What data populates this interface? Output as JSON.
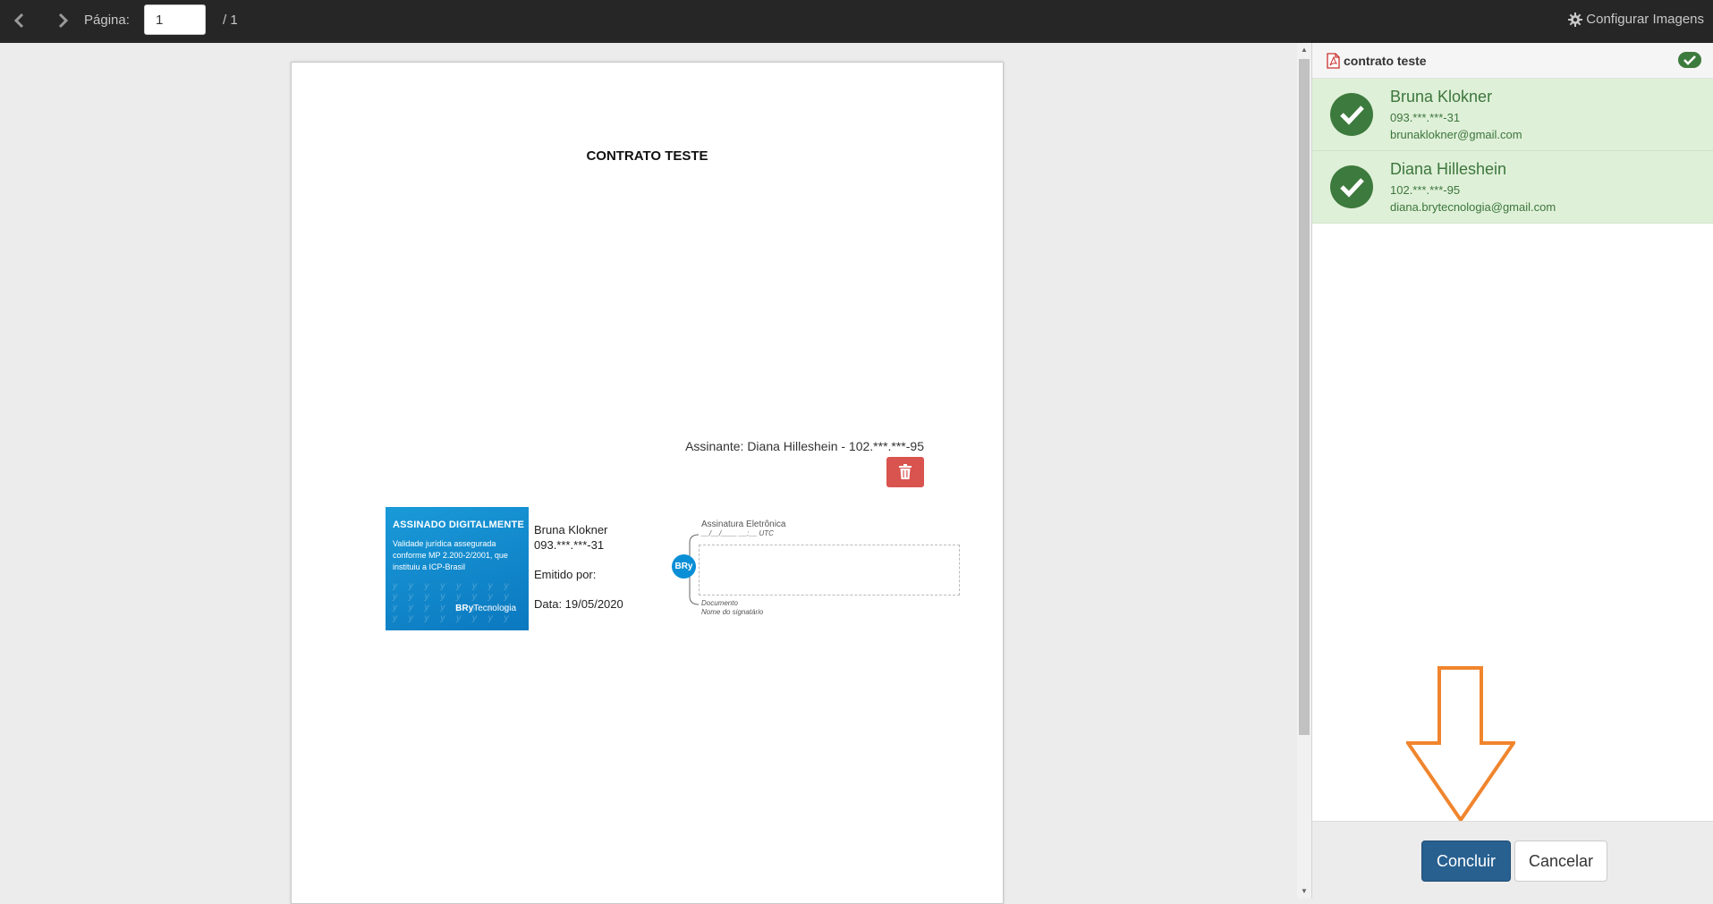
{
  "toolbar": {
    "page_label": "Página:",
    "page_value": "1",
    "page_total": "/ 1",
    "config_images_label": "Configurar Imagens"
  },
  "document": {
    "title": "CONTRATO TESTE",
    "signer_line": "Assinante: Diana Hilleshein - 102.***.***-95",
    "stamp": {
      "title": "ASSINADO DIGITALMENTE",
      "text": "Validade jurídica assegurada conforme MP 2.200-2/2001, que instituiu a ICP-Brasil",
      "brand_bold": "BRy",
      "brand_rest": "Tecnologia",
      "color": "#1a9ad9"
    },
    "signature_info": {
      "name": "Bruna Klokner",
      "cpf": "093.***.***-31",
      "issued_by": "Emitido por:",
      "date": "Data: 19/05/2020"
    },
    "electronic_signature": {
      "title": "Assinatura Eletrônica",
      "date_placeholder": "__/__/____  __:__ UTC",
      "badge": "BRy",
      "doc_label": "Documento",
      "signer_label": "Nome do signatário"
    }
  },
  "panel": {
    "doc_name": "contrato teste",
    "signers": [
      {
        "name": "Bruna Klokner",
        "cpf": "093.***.***-31",
        "email": "brunaklokner@gmail.com"
      },
      {
        "name": "Diana Hilleshein",
        "cpf": "102.***.***-95",
        "email": "diana.brytecnologia@gmail.com"
      }
    ],
    "conclude_label": "Concluir",
    "cancel_label": "Cancelar"
  },
  "colors": {
    "toolbar_bg": "#262626",
    "success_bg": "#dff0d8",
    "success_text": "#3c763d",
    "check_green": "#3d7a3d",
    "danger": "#d9534f",
    "primary": "#286090",
    "annotation_arrow": "#f0852d"
  },
  "icons": [
    "chevron-left-icon",
    "chevron-right-icon",
    "gear-icon",
    "trash-icon",
    "pdf-file-icon",
    "check-badge-icon",
    "check-circle-icon",
    "down-arrow-annotation"
  ]
}
